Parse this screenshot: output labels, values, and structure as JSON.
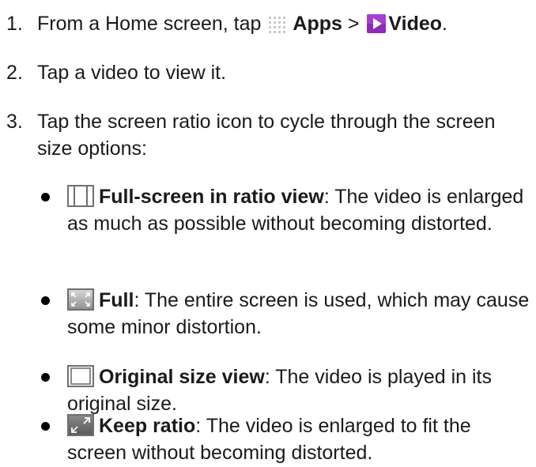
{
  "steps": [
    {
      "number": "1.",
      "text_before": "From a Home screen, tap",
      "apps_icon": "apps-grid-icon",
      "apps_label": "Apps",
      "separator": ">",
      "video_icon": "video-app-icon",
      "video_label": "Video",
      "end": "."
    },
    {
      "number": "2.",
      "text": "Tap a video to view it."
    },
    {
      "number": "3.",
      "text": "Tap the screen ratio icon to cycle through the screen size options:"
    }
  ],
  "options": [
    {
      "icon": "full-screen-in-ratio-view-icon",
      "title": "Full-screen in ratio view",
      "description": ": The video is enlarged as much as possible without becoming distorted."
    },
    {
      "icon": "full-screen-icon",
      "title": "Full",
      "description": ": The entire screen is used, which may cause some minor distortion."
    },
    {
      "icon": "original-size-view-icon",
      "title": "Original size view",
      "description": ": The video is played in its original size."
    },
    {
      "icon": "keep-ratio-icon",
      "title": "Keep ratio",
      "description": ": The video is enlarged to fit the screen without becoming distorted."
    }
  ],
  "colors": {
    "text": "#1a1a1a",
    "apps_icon_dots": "#c9c9c9",
    "video_icon_bg": "#8e2bb8",
    "ratio_icon_border": "#6f6f6f"
  }
}
